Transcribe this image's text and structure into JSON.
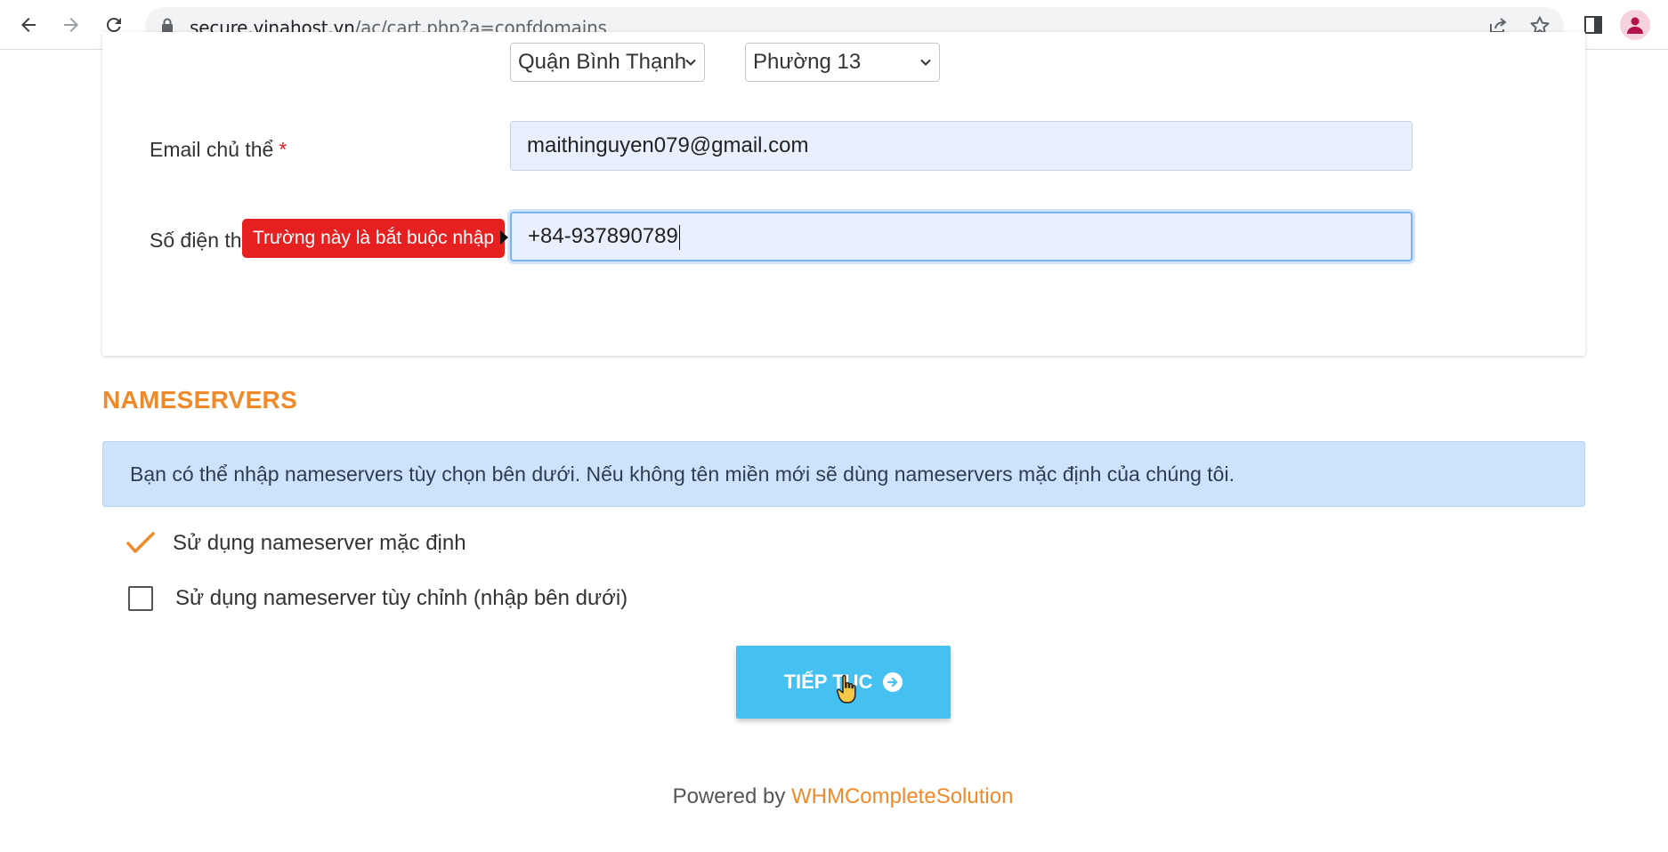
{
  "browser": {
    "url_host": "secure.vinahost.vn",
    "url_path": "/ac/cart.php?a=confdomains"
  },
  "form": {
    "district_select": "Quận Bình Thạnh",
    "ward_select": "Phường 13",
    "email_label": "Email chủ thể",
    "email_value": "maithinguyen079@gmail.com",
    "phone_label": "Số điện th",
    "phone_value": "+84-937890789",
    "required_mark": "*",
    "tooltip": "Trường này là bắt buộc nhập"
  },
  "nameservers": {
    "title": "NAMESERVERS",
    "info": "Bạn có thể nhập nameservers tùy chọn bên dưới. Nếu không tên miền mới sẽ dùng nameservers mặc định của chúng tôi.",
    "option_default": "Sử dụng nameserver mặc định",
    "option_custom": "Sử dụng nameserver tùy chỉnh (nhập bên dưới)",
    "continue_label": "TIẾP TỤC"
  },
  "footer": {
    "powered_by": "Powered by",
    "link": "WHMCompleteSolution"
  },
  "colors": {
    "accent": "#f0892a",
    "button": "#44c1f1",
    "tooltip": "#e62020",
    "info_bg": "#cce3fb"
  }
}
